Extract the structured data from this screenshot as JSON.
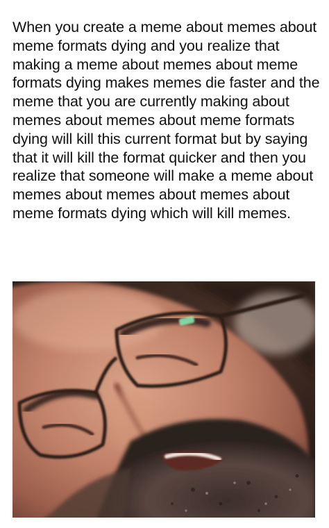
{
  "meme": {
    "caption": "When you create a meme about memes about meme formats dying and you realize that making a meme about memes about meme formats dying makes memes die faster and the  meme that you are currently making about memes about memes about meme formats dying will kill this current format but by saying that it will kill the format quicker and then you realize that someone will make a meme about memes about memes about memes about meme formats dying which will kill memes.",
    "image_subject": "close-up-man-glasses-grimacing"
  }
}
